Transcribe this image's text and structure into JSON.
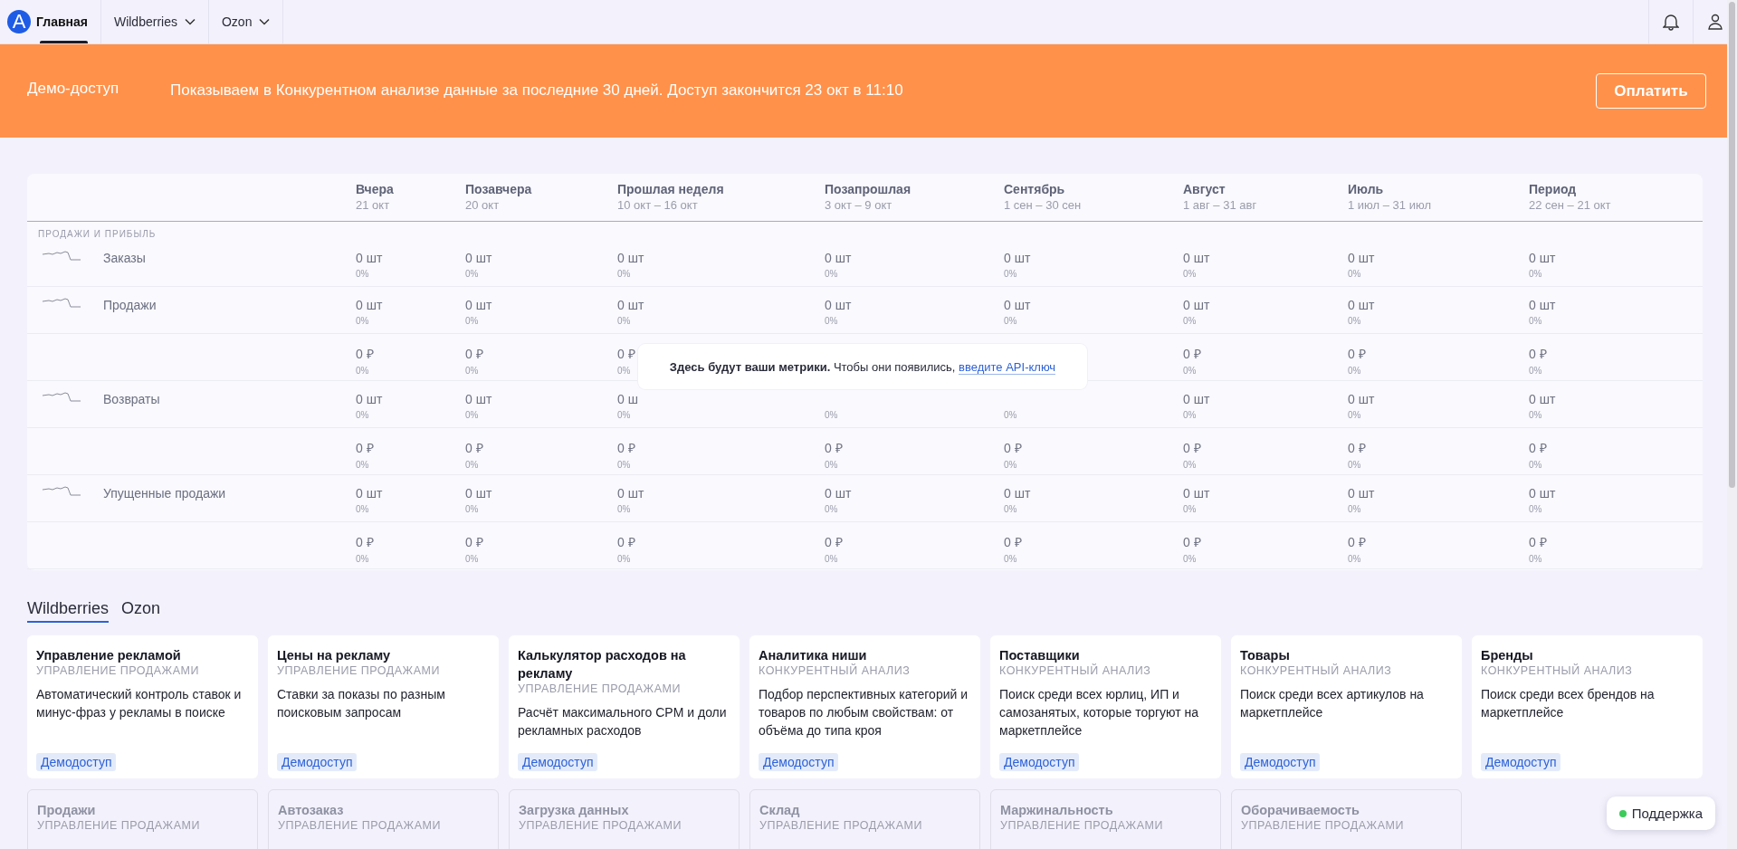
{
  "topbar": {
    "logo": "A",
    "tabs": [
      {
        "label": "Главная",
        "selected": true,
        "dropdown": false
      },
      {
        "label": "Wildberries",
        "selected": false,
        "dropdown": true
      },
      {
        "label": "Ozon",
        "selected": false,
        "dropdown": true
      }
    ]
  },
  "banner": {
    "title": "Демо-доступ",
    "message": "Показываем в Конкурентном анализе данные за последние 30 дней. Доступ закончится 23 окт в 11:10",
    "button": "Оплатить"
  },
  "metrics": {
    "columns": [
      {
        "label": "Вчера",
        "period": "21 окт"
      },
      {
        "label": "Позавчера",
        "period": "20 окт"
      },
      {
        "label": "Прошлая неделя",
        "period": "10 окт – 16 окт"
      },
      {
        "label": "Позапрошлая",
        "period": "3 окт – 9 окт"
      },
      {
        "label": "Сентябрь",
        "period": "1 сен – 30 сен"
      },
      {
        "label": "Август",
        "period": "1 авг – 31 авг"
      },
      {
        "label": "Июль",
        "period": "1 июл – 31 июл"
      },
      {
        "label": "Период",
        "period": "22 сен – 21 окт"
      }
    ],
    "section": "ПРОДАЖИ И ПРИБЫЛЬ",
    "groups": [
      {
        "label": "Заказы",
        "rows": [
          [
            {
              "value": "0 шт",
              "change": "0%"
            },
            {
              "value": "0 шт",
              "change": "0%"
            },
            {
              "value": "0 шт",
              "change": "0%"
            },
            {
              "value": "0 шт",
              "change": "0%"
            },
            {
              "value": "0 шт",
              "change": "0%"
            },
            {
              "value": "0 шт",
              "change": "0%"
            },
            {
              "value": "0 шт",
              "change": "0%"
            },
            {
              "value": "0 шт",
              "change": "0%"
            }
          ]
        ]
      },
      {
        "label": "Продажи",
        "rows": [
          [
            {
              "value": "0 шт",
              "change": "0%"
            },
            {
              "value": "0 шт",
              "change": "0%"
            },
            {
              "value": "0 шт",
              "change": "0%"
            },
            {
              "value": "0 шт",
              "change": "0%"
            },
            {
              "value": "0 шт",
              "change": "0%"
            },
            {
              "value": "0 шт",
              "change": "0%"
            },
            {
              "value": "0 шт",
              "change": "0%"
            },
            {
              "value": "0 шт",
              "change": "0%"
            }
          ],
          [
            {
              "value": "0 ₽",
              "change": "0%"
            },
            {
              "value": "0 ₽",
              "change": "0%"
            },
            {
              "value": "0 ₽",
              "change": "0%"
            },
            {},
            {},
            {
              "value": "0 ₽",
              "change": "0%"
            },
            {
              "value": "0 ₽",
              "change": "0%"
            },
            {
              "value": "0 ₽",
              "change": "0%"
            }
          ]
        ]
      },
      {
        "label": "Возвраты",
        "rows": [
          [
            {
              "value": "0 шт",
              "change": "0%"
            },
            {
              "value": "0 шт",
              "change": "0%"
            },
            {
              "value": "0 ш",
              "change": "0%"
            },
            {
              "change": "0%"
            },
            {
              "change": "0%"
            },
            {
              "value": "0 шт",
              "change": "0%"
            },
            {
              "value": "0 шт",
              "change": "0%"
            },
            {
              "value": "0 шт",
              "change": "0%"
            }
          ],
          [
            {
              "value": "0 ₽",
              "change": "0%"
            },
            {
              "value": "0 ₽",
              "change": "0%"
            },
            {
              "value": "0 ₽",
              "change": "0%"
            },
            {
              "value": "0 ₽",
              "change": "0%"
            },
            {
              "value": "0 ₽",
              "change": "0%"
            },
            {
              "value": "0 ₽",
              "change": "0%"
            },
            {
              "value": "0 ₽",
              "change": "0%"
            },
            {
              "value": "0 ₽",
              "change": "0%"
            }
          ]
        ]
      },
      {
        "label": "Упущенные продажи",
        "rows": [
          [
            {
              "value": "0 шт",
              "change": "0%"
            },
            {
              "value": "0 шт",
              "change": "0%"
            },
            {
              "value": "0 шт",
              "change": "0%"
            },
            {
              "value": "0 шт",
              "change": "0%"
            },
            {
              "value": "0 шт",
              "change": "0%"
            },
            {
              "value": "0 шт",
              "change": "0%"
            },
            {
              "value": "0 шт",
              "change": "0%"
            },
            {
              "value": "0 шт",
              "change": "0%"
            }
          ],
          [
            {
              "value": "0 ₽",
              "change": "0%"
            },
            {
              "value": "0 ₽",
              "change": "0%"
            },
            {
              "value": "0 ₽",
              "change": "0%"
            },
            {
              "value": "0 ₽",
              "change": "0%"
            },
            {
              "value": "0 ₽",
              "change": "0%"
            },
            {
              "value": "0 ₽",
              "change": "0%"
            },
            {
              "value": "0 ₽",
              "change": "0%"
            },
            {
              "value": "0 ₽",
              "change": "0%"
            }
          ]
        ]
      }
    ],
    "notice": {
      "text": "**Здесь будут ваши метрики.** Чтобы они появились, ",
      "link": "введите API-ключ"
    }
  },
  "services": {
    "tabs": [
      {
        "label": "Wildberries",
        "selected": true
      },
      {
        "label": "Ozon",
        "selected": false
      }
    ],
    "cards": [
      {
        "title": "Управление рекламой",
        "category": "УПРАВЛЕНИЕ ПРОДАЖАМИ",
        "description": "Автоматический контроль ставок и минус-фраз у рекламы в поиске",
        "badge": "Демодоступ",
        "disabled": false
      },
      {
        "title": "Цены на рекламу",
        "category": "УПРАВЛЕНИЕ ПРОДАЖАМИ",
        "description": "Ставки за показы по разным поисковым запросам",
        "badge": "Демодоступ",
        "disabled": false
      },
      {
        "title": "Калькулятор расходов на рекламу",
        "category": "УПРАВЛЕНИЕ ПРОДАЖАМИ",
        "description": "Расчёт максимального CPM и доли рекламных расходов",
        "badge": "Демодоступ",
        "disabled": false
      },
      {
        "title": "Аналитика ниши",
        "category": "КОНКУРЕНТНЫЙ АНАЛИЗ",
        "description": "Подбор перспективных категорий и товаров по любым свойствам: от объёма до типа кроя",
        "badge": "Демодоступ",
        "disabled": false
      },
      {
        "title": "Поставщики",
        "category": "КОНКУРЕНТНЫЙ АНАЛИЗ",
        "description": "Поиск среди всех юрлиц, ИП и самозанятых, которые торгуют на маркетплейсе",
        "badge": "Демодоступ",
        "disabled": false
      },
      {
        "title": "Товары",
        "category": "КОНКУРЕНТНЫЙ АНАЛИЗ",
        "description": "Поиск среди всех артикулов на маркетплейсе",
        "badge": "Демодоступ",
        "disabled": false
      },
      {
        "title": "Бренды",
        "category": "КОНКУРЕНТНЫЙ АНАЛИЗ",
        "description": "Поиск среди всех брендов на маркетплейсе",
        "badge": "Демодоступ",
        "disabled": false
      },
      {
        "title": "Продажи",
        "category": "УПРАВЛЕНИЕ ПРОДАЖАМИ",
        "disabled": true
      },
      {
        "title": "Автозаказ",
        "category": "УПРАВЛЕНИЕ ПРОДАЖАМИ",
        "disabled": true
      },
      {
        "title": "Загрузка данных",
        "category": "УПРАВЛЕНИЕ ПРОДАЖАМИ",
        "disabled": true
      },
      {
        "title": "Склад",
        "category": "УПРАВЛЕНИЕ ПРОДАЖАМИ",
        "disabled": true
      },
      {
        "title": "Маржинальность",
        "category": "УПРАВЛЕНИЕ ПРОДАЖАМИ",
        "disabled": true
      },
      {
        "title": "Оборачиваемость",
        "category": "УПРАВЛЕНИЕ ПРОДАЖАМИ",
        "disabled": true
      }
    ]
  },
  "support": {
    "label": "Поддержка",
    "online": true
  }
}
